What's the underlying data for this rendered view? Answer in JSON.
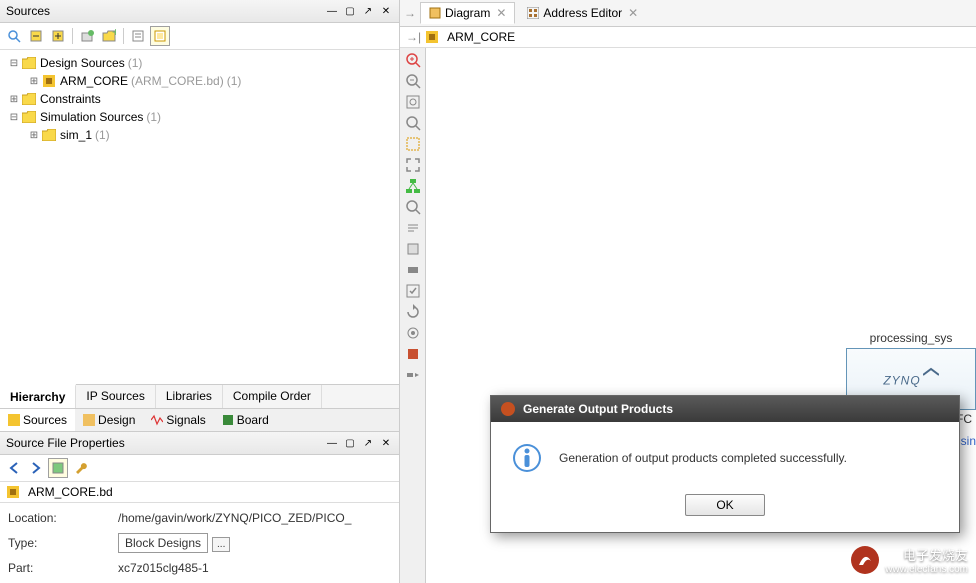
{
  "sources": {
    "title": "Sources",
    "tree": {
      "design_sources": {
        "label": "Design Sources",
        "count": "(1)"
      },
      "arm_core": {
        "label": "ARM_CORE",
        "path": "(ARM_CORE.bd)",
        "count": "(1)"
      },
      "constraints": {
        "label": "Constraints"
      },
      "sim_sources": {
        "label": "Simulation Sources",
        "count": "(1)"
      },
      "sim_1": {
        "label": "sim_1",
        "count": "(1)"
      }
    },
    "bottom_tabs": {
      "hierarchy": "Hierarchy",
      "ip_sources": "IP Sources",
      "libraries": "Libraries",
      "compile_order": "Compile Order"
    },
    "sub_tabs": {
      "sources": "Sources",
      "design": "Design",
      "signals": "Signals",
      "board": "Board"
    }
  },
  "properties": {
    "title": "Source File Properties",
    "file": "ARM_CORE.bd",
    "rows": {
      "location": {
        "key": "Location:",
        "val": "/home/gavin/work/ZYNQ/PICO_ZED/PICO_"
      },
      "type": {
        "key": "Type:",
        "val": "Block Designs"
      },
      "part": {
        "key": "Part:",
        "val": "xc7z015clg485-1"
      }
    }
  },
  "diagram": {
    "tabs": {
      "diagram": "Diagram",
      "address_editor": "Address Editor"
    },
    "name": "ARM_CORE",
    "block": {
      "label": "processing_sys",
      "logo": "ZYNQ",
      "fc": "FC",
      "sublabel": "Processin"
    }
  },
  "dialog": {
    "title": "Generate Output Products",
    "message": "Generation of output products completed successfully.",
    "ok": "OK"
  },
  "watermark": {
    "name": "电子发烧友",
    "url": "www.elecfans.com"
  }
}
